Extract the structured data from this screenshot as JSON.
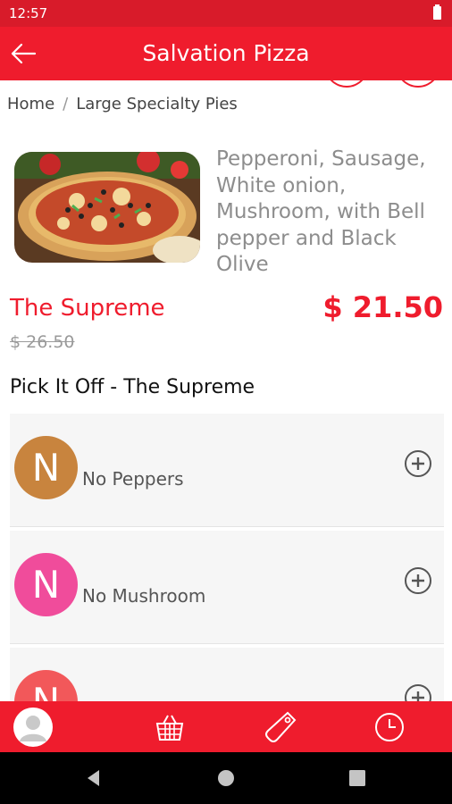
{
  "status_bar": {
    "time": "12:57"
  },
  "app_bar": {
    "title": "Salvation Pizza"
  },
  "breadcrumb": {
    "home": "Home",
    "separator": "/",
    "current": "Large Specialty Pies"
  },
  "product": {
    "image_icon": "pizza-photo",
    "description": "Pepperoni, Sausage, White onion, Mushroom, with Bell pepper and Black Olive",
    "name": "The Supreme",
    "price": "$ 21.50",
    "old_price": "$ 26.50"
  },
  "section": {
    "title": "Pick It Off - The Supreme"
  },
  "options": [
    {
      "initial": "N",
      "label": "No Peppers",
      "color": "#c8843e"
    },
    {
      "initial": "N",
      "label": "No Mushroom",
      "color": "#f04c9b"
    },
    {
      "initial": "N",
      "label": "",
      "color": "#f2585a"
    }
  ],
  "bottom_nav": {
    "items": [
      "profile-icon",
      "basket-icon",
      "tag-icon",
      "clock-icon"
    ]
  },
  "colors": {
    "primary": "#ef1c2d",
    "status_bar": "#d81b2a",
    "accent_text": "#ef1c2d"
  }
}
